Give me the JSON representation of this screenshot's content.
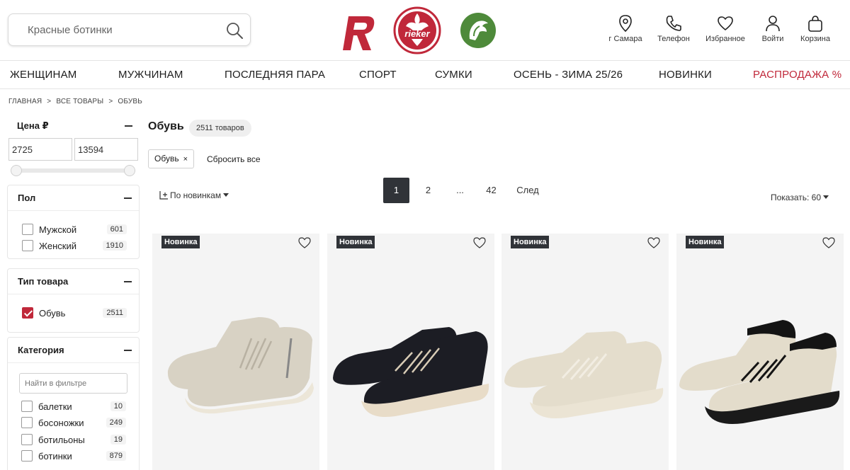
{
  "search": {
    "placeholder": "Красные ботинки"
  },
  "header_icons": [
    {
      "label": "г Самара",
      "icon": "location-pin-icon"
    },
    {
      "label": "Телефон",
      "icon": "phone-icon"
    },
    {
      "label": "Избранное",
      "icon": "heart-icon"
    },
    {
      "label": "Войти",
      "icon": "user-icon"
    },
    {
      "label": "Корзина",
      "icon": "bag-icon"
    }
  ],
  "logos": {
    "rieker_text": "rieker"
  },
  "nav": [
    "ЖЕНЩИНАМ",
    "МУЖЧИНАМ",
    "ПОСЛЕДНЯЯ ПАРА",
    "СПОРТ",
    "СУМКИ",
    "ОСЕНЬ - ЗИМА 25/26",
    "НОВИНКИ",
    "РАСПРОДАЖА %"
  ],
  "breadcrumb": [
    "ГЛАВНАЯ",
    ">",
    "ВСЕ ТОВАРЫ",
    ">",
    "ОБУВЬ"
  ],
  "filters": {
    "price": {
      "title": "Цена ₽",
      "min": "2725",
      "max": "13594"
    },
    "gender": {
      "title": "Пол",
      "options": [
        {
          "label": "Мужской",
          "count": "601",
          "checked": false
        },
        {
          "label": "Женский",
          "count": "1910",
          "checked": false
        }
      ]
    },
    "type": {
      "title": "Тип товара",
      "options": [
        {
          "label": "Обувь",
          "count": "2511",
          "checked": true
        }
      ]
    },
    "category": {
      "title": "Категория",
      "search_placeholder": "Найти в фильтре",
      "options": [
        {
          "label": "балетки",
          "count": "10",
          "checked": false
        },
        {
          "label": "босоножки",
          "count": "249",
          "checked": false
        },
        {
          "label": "ботильоны",
          "count": "19",
          "checked": false
        },
        {
          "label": "ботинки",
          "count": "879",
          "checked": false
        }
      ]
    }
  },
  "main": {
    "title": "Обувь",
    "count": "2511 товаров",
    "active_filter": "Обувь",
    "remove_symbol": "×",
    "reset": "Сбросить все",
    "sort": "По новинкам",
    "pagination": [
      "1",
      "2",
      "...",
      "42",
      "След"
    ],
    "show": "Показать: 60"
  },
  "products": [
    {
      "badge": "Новинка",
      "colors": {
        "upper": "#d8d2c4",
        "sole": "#ece6d8",
        "lace": "#b8b1a2"
      }
    },
    {
      "badge": "Новинка",
      "colors": {
        "upper": "#1c1d24",
        "sole": "#e8dcc8",
        "lace": "#d8ccb6"
      }
    },
    {
      "badge": "Новинка",
      "colors": {
        "upper": "#e4ddcc",
        "sole": "#ebe4d4",
        "lace": "#f2ede2"
      }
    },
    {
      "badge": "Новинка",
      "colors": {
        "upper": "#e3dccb",
        "sole": "#1a1a1a",
        "lace": "#141414"
      }
    }
  ],
  "colors": {
    "brand_red": "#c0283a",
    "dark": "#303338",
    "green": "#4e8a3a"
  }
}
